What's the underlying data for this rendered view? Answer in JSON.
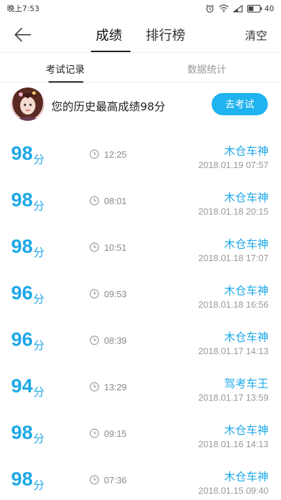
{
  "status": {
    "time": "晚上7:53",
    "battery": "40"
  },
  "nav": {
    "tabs": [
      "成绩",
      "排行榜"
    ],
    "active_tab": 0,
    "clear_label": "清空"
  },
  "sub_tabs": [
    "考试记录",
    "数据统计"
  ],
  "summary": {
    "text": "您的历史最高成绩98分",
    "button_label": "去考试"
  },
  "score_unit": "分",
  "records": [
    {
      "score": "98",
      "duration": "12:25",
      "examiner": "木仓车神",
      "datetime": "2018.01.19  07:57"
    },
    {
      "score": "98",
      "duration": "08:01",
      "examiner": "木仓车神",
      "datetime": "2018.01.18  20:15"
    },
    {
      "score": "98",
      "duration": "10:51",
      "examiner": "木仓车神",
      "datetime": "2018.01.18  17:07"
    },
    {
      "score": "96",
      "duration": "09:53",
      "examiner": "木仓车神",
      "datetime": "2018.01.18  16:56"
    },
    {
      "score": "96",
      "duration": "08:39",
      "examiner": "木仓车神",
      "datetime": "2018.01.17  14:13"
    },
    {
      "score": "94",
      "duration": "13:29",
      "examiner": "驾考车王",
      "datetime": "2018.01.17  13:59"
    },
    {
      "score": "98",
      "duration": "09:15",
      "examiner": "木仓车神",
      "datetime": "2018.01.16  14:13"
    },
    {
      "score": "98",
      "duration": "07:36",
      "examiner": "木仓车神",
      "datetime": "2018.01.15  09:40"
    }
  ],
  "colors": {
    "accent": "#1da8e8",
    "button": "#1fb3ef"
  },
  "icons": [
    "back-arrow-icon",
    "clock-icon",
    "alarm-icon",
    "wifi-icon",
    "signal-icon",
    "battery-icon"
  ]
}
